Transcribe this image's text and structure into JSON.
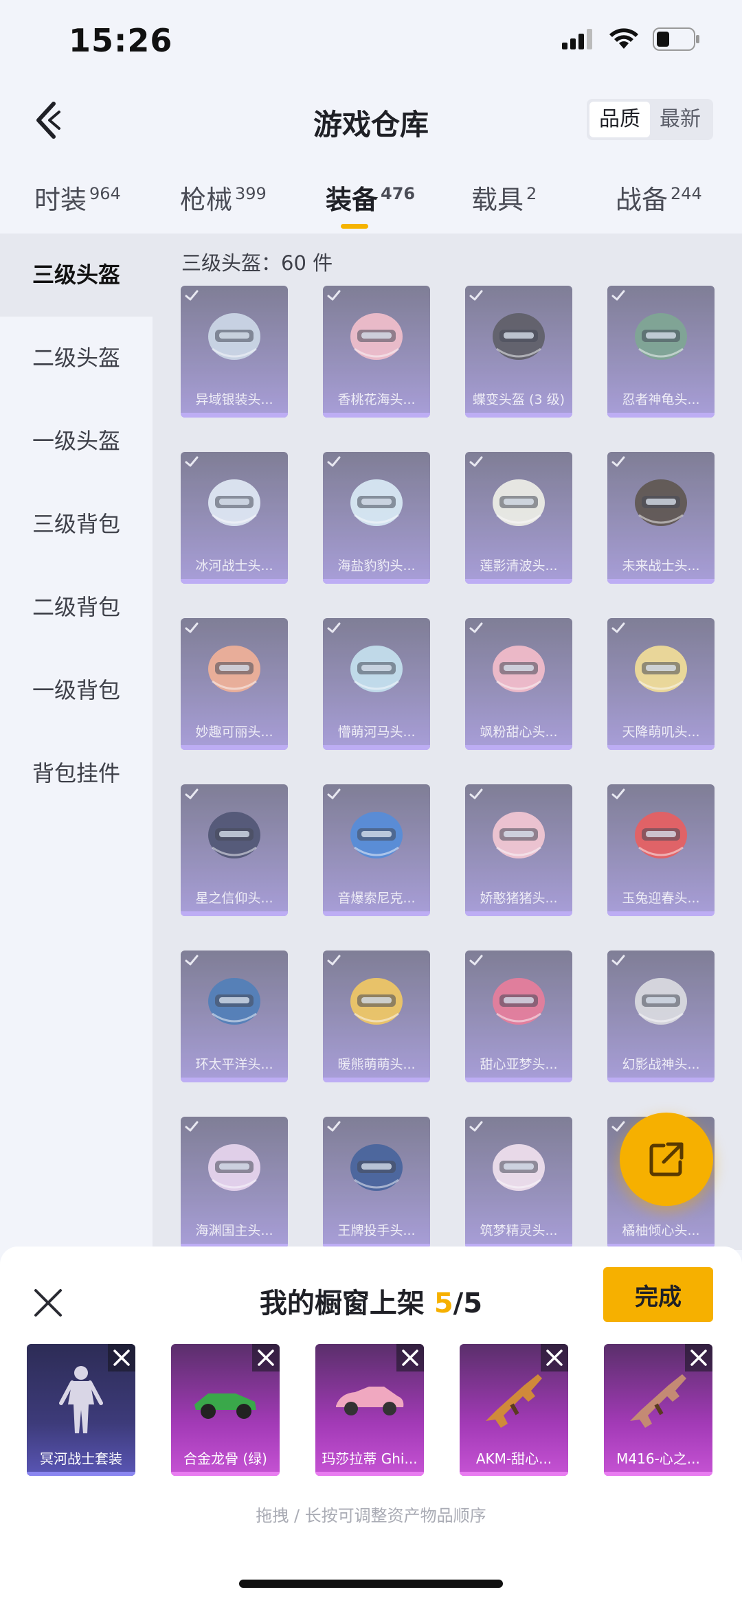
{
  "status_bar": {
    "time": "15:26"
  },
  "header": {
    "title": "游戏仓库",
    "sort_options": [
      "品质",
      "最新"
    ],
    "sort_active": "品质"
  },
  "tabs": [
    {
      "label": "时装",
      "count": "964"
    },
    {
      "label": "枪械",
      "count": "399"
    },
    {
      "label": "装备",
      "count": "476",
      "active": true
    },
    {
      "label": "载具",
      "count": "2"
    },
    {
      "label": "战备",
      "count": "244"
    }
  ],
  "sidebar": {
    "items": [
      {
        "label": "三级头盔",
        "active": true
      },
      {
        "label": "二级头盔"
      },
      {
        "label": "一级头盔"
      },
      {
        "label": "三级背包"
      },
      {
        "label": "二级背包"
      },
      {
        "label": "一级背包"
      },
      {
        "label": "背包挂件"
      }
    ]
  },
  "content": {
    "count_label": "三级头盔：60 件",
    "items": [
      {
        "name": "异域银装头..."
      },
      {
        "name": "香桃花海头..."
      },
      {
        "name": "蝶变头盔 (3 级)"
      },
      {
        "name": "忍者神龟头..."
      },
      {
        "name": "冰河战士头..."
      },
      {
        "name": "海盐豹豹头..."
      },
      {
        "name": "莲影清波头..."
      },
      {
        "name": "未来战士头..."
      },
      {
        "name": "妙趣可丽头..."
      },
      {
        "name": "懵萌河马头..."
      },
      {
        "name": "飒粉甜心头..."
      },
      {
        "name": "天降萌叽头..."
      },
      {
        "name": "星之信仰头..."
      },
      {
        "name": "音爆索尼克..."
      },
      {
        "name": "娇憨猪猪头..."
      },
      {
        "name": "玉兔迎春头..."
      },
      {
        "name": "环太平洋头..."
      },
      {
        "name": "暖熊萌萌头..."
      },
      {
        "name": "甜心亚梦头..."
      },
      {
        "name": "幻影战神头..."
      },
      {
        "name": "海渊国主头..."
      },
      {
        "name": "王牌投手头..."
      },
      {
        "name": "筑梦精灵头..."
      },
      {
        "name": "橘柚倾心头..."
      }
    ]
  },
  "sheet": {
    "title_prefix": "我的橱窗上架",
    "current": "5",
    "separator": "/",
    "total": "5",
    "done_label": "完成",
    "shelf_items": [
      {
        "name": "冥河战士套装"
      },
      {
        "name": "合金龙骨 (绿)"
      },
      {
        "name": "玛莎拉蒂 Ghi..."
      },
      {
        "name": "AKM-甜心..."
      },
      {
        "name": "M416-心之..."
      }
    ],
    "hint": "拖拽 / 长按可调整资产物品顺序"
  },
  "colors": {
    "accent": "#f6b000",
    "background": "#f2f4fa",
    "panel": "#e6e8ef",
    "card_purple": "#9f93d6",
    "shelf_magenta": "#c653d4"
  },
  "icons": [
    "back-arrow-icon",
    "signal-icon",
    "wifi-icon",
    "battery-icon",
    "check-icon",
    "helmet-icon",
    "share-icon",
    "close-icon",
    "remove-icon"
  ]
}
